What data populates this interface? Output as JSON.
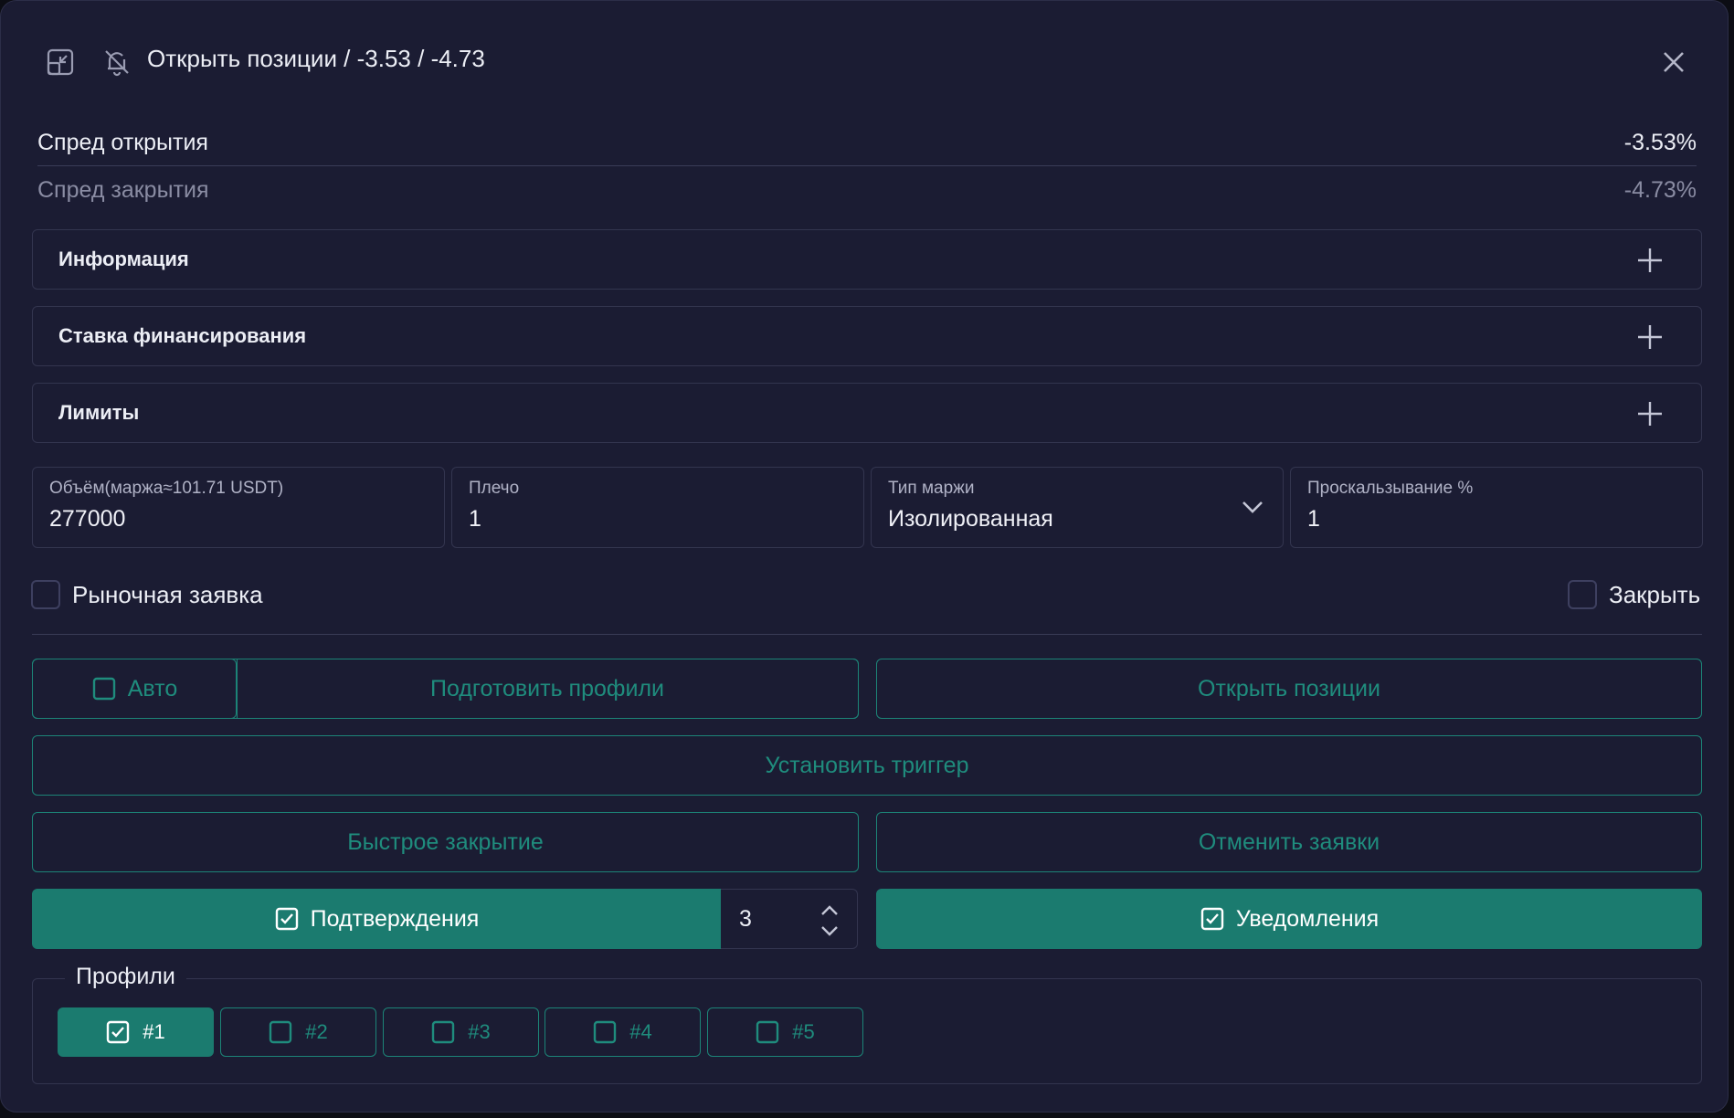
{
  "header": {
    "title": "Открыть позиции / -3.53 / -4.73",
    "icons": [
      "collapse-icon",
      "bell-off-icon",
      "close-icon"
    ]
  },
  "spreads": {
    "open_label": "Спред открытия",
    "open_value": "-3.53%",
    "close_label": "Спред закрытия",
    "close_value": "-4.73%"
  },
  "sections": [
    {
      "label": "Информация"
    },
    {
      "label": "Ставка финансирования"
    },
    {
      "label": "Лимиты"
    }
  ],
  "fields": {
    "volume": {
      "label": "Объём(маржа≈101.71 USDT)",
      "value": "277000"
    },
    "leverage": {
      "label": "Плечо",
      "value": "1"
    },
    "margin_type": {
      "label": "Тип маржи",
      "value": "Изолированная"
    },
    "slippage": {
      "label": "Проскальзывание %",
      "value": "1"
    }
  },
  "options": {
    "market_order": {
      "label": "Рыночная заявка",
      "checked": false
    },
    "close": {
      "label": "Закрыть",
      "checked": false
    }
  },
  "buttons": {
    "auto": "Авто",
    "prepare_profiles": "Подготовить профили",
    "open_positions": "Открыть позиции",
    "set_trigger": "Установить триггер",
    "quick_close": "Быстрое закрытие",
    "cancel_orders": "Отменить заявки",
    "confirmations": "Подтверждения",
    "notifications": "Уведомления"
  },
  "confirmations_count": "3",
  "profiles": {
    "title": "Профили",
    "items": [
      {
        "label": "#1",
        "checked": true
      },
      {
        "label": "#2",
        "checked": false
      },
      {
        "label": "#3",
        "checked": false
      },
      {
        "label": "#4",
        "checked": false
      },
      {
        "label": "#5",
        "checked": false
      }
    ]
  },
  "colors": {
    "background": "#1b1c33",
    "accent": "#1b7b6f",
    "accent_text": "#1f8c7d",
    "border": "#33354f"
  }
}
